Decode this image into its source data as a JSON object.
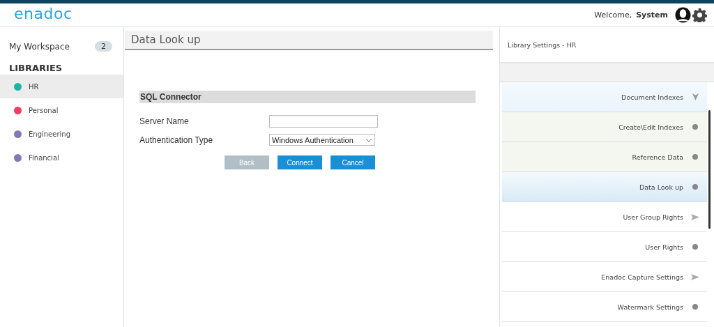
{
  "header": {
    "logo": "enadoc",
    "welcome": "Welcome,",
    "user": "System"
  },
  "sidebar": {
    "workspace": {
      "label": "My Workspace",
      "count": "2"
    },
    "section": "LIBRARIES",
    "items": [
      {
        "label": "HR",
        "color": "#1bb5a6",
        "selected": true
      },
      {
        "label": "Personal",
        "color": "#f03e62",
        "selected": false
      },
      {
        "label": "Engineering",
        "color": "#8479b8",
        "selected": false
      },
      {
        "label": "Financial",
        "color": "#8479b8",
        "selected": false
      }
    ]
  },
  "main": {
    "title": "Data Look up",
    "section": "SQL Connector",
    "fields": [
      {
        "kind": "text",
        "label": "Server Name"
      },
      {
        "kind": "select",
        "label": "Authentication Type",
        "value": "Windows Authentication"
      }
    ],
    "buttons": [
      {
        "label": "Back",
        "disabled": true
      },
      {
        "label": "Connect",
        "disabled": false
      },
      {
        "label": "Cancel",
        "disabled": false
      }
    ]
  },
  "settings": {
    "title": "Library Settings - HR",
    "items": [
      {
        "label": "Document Indexes",
        "kind": "group",
        "expanded": true,
        "selected": false,
        "children": [
          {
            "label": "Create\\Edit Indexes",
            "kind": "item",
            "selected": false
          },
          {
            "label": "Reference Data",
            "kind": "item",
            "selected": false
          },
          {
            "label": "Data Look up",
            "kind": "item",
            "selected": true
          }
        ]
      },
      {
        "label": "User Group Rights",
        "kind": "group",
        "expanded": false,
        "selected": false
      },
      {
        "label": "User Rights",
        "kind": "item",
        "selected": false
      },
      {
        "label": "Enadoc Capture Settings",
        "kind": "group",
        "expanded": false,
        "selected": false
      },
      {
        "label": "Watermark Settings",
        "kind": "item",
        "selected": false
      }
    ]
  }
}
